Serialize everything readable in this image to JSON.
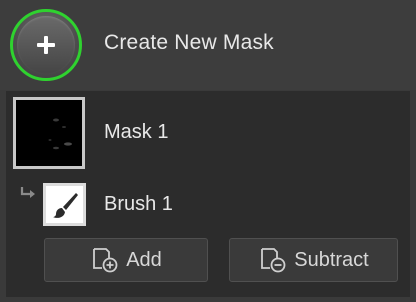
{
  "header": {
    "create_button_icon": "plus-icon",
    "create_label": "Create New Mask",
    "highlight_color": "#2fd22f"
  },
  "masks": [
    {
      "label": "Mask 1",
      "thumbnail": "mask-preview",
      "components": [
        {
          "label": "Brush 1",
          "icon": "brush-icon"
        }
      ]
    }
  ],
  "actions": {
    "add_label": "Add",
    "add_icon": "add-shape-icon",
    "subtract_label": "Subtract",
    "subtract_icon": "subtract-shape-icon"
  }
}
